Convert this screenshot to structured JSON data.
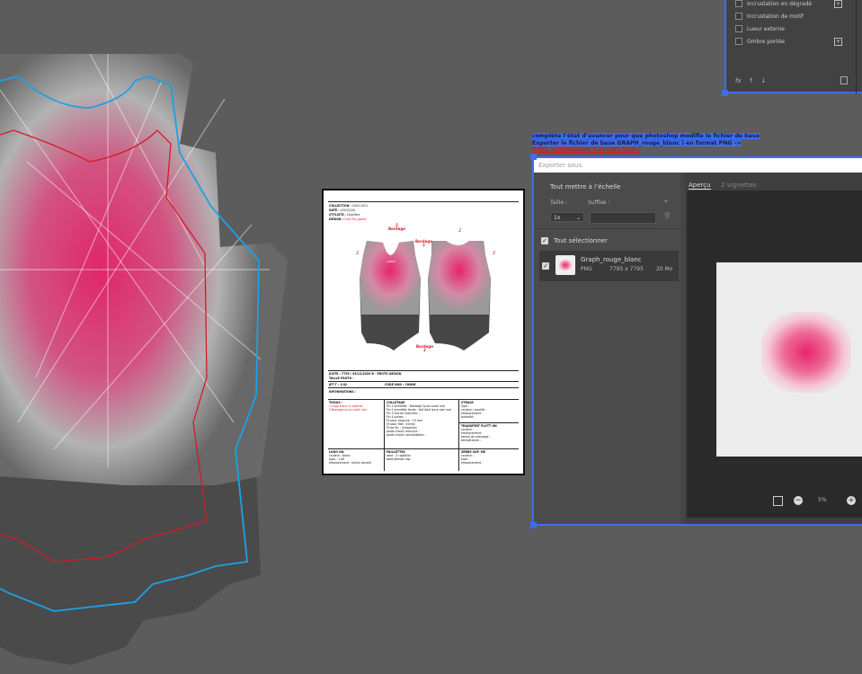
{
  "layer_style_panel": {
    "rows": [
      {
        "label": "Incrustation en dégradé",
        "has_plus": true
      },
      {
        "label": "Incrustation de motif",
        "has_plus": false
      },
      {
        "label": "Lueur externe",
        "has_plus": false
      },
      {
        "label": "Ombre portée",
        "has_plus": true
      }
    ],
    "footer_fx": "fx"
  },
  "note": {
    "line1": "complète l’état d’avancer pour que photoshop modifie le fichier de base",
    "line2": "Exporter le fichier de base GRAPH_rouge_blanc ) en format PNG ->",
    "line3": "JPEG, compression 1  et nom final :"
  },
  "document": {
    "header": [
      {
        "k": "COLLECTION :",
        "v": "2020-2021"
      },
      {
        "k": "DATE :",
        "v": "(03/12/20)"
      },
      {
        "k": "STYLISTE :",
        "v": "Charlène"
      },
      {
        "k": "DESIGN :",
        "v": "Club Pro_Agnès"
      }
    ],
    "bordage_top": "Bordage",
    "bordage_top2": "Bordage",
    "bordage_bottom": "Bordage",
    "num": "2",
    "logo": "ALPHA",
    "mid": [
      "JUSTE : 7799 / 05/12/2020 B - PROTO DESIGN",
      "TAILLE PROTO :",
      "JET T : 1/42",
      "CODE NUN : CHN98"
    ],
    "informations": "INFORMATIONS :",
    "tissus_title": "TISSUS :",
    "tissus": [
      "1 lingo blanc & sublimé",
      "2 Bordage lycra corail noir"
    ],
    "coloris_title": "COLLETAGE",
    "coloris": [
      "Fin 1 emmêler : Bordage lycra corail noir",
      "Fin 2 emmêler fonds : fait dixit lycra noir noir",
      "Fin 3 fort de manches :",
      "Fin 4 autres :",
      "",
      "Fil pour coupure : 10 mm",
      "Fil pour fixé : 40mm",
      "Fil de fer : Cheppillon",
      "poids d'outil recouvre :",
      "poids d'outil consolidation :"
    ],
    "strass_title": "STRASS",
    "strass": [
      "type :",
      "couleur / qualité :",
      "emplacement :",
      "quantité :"
    ],
    "transfert_title": "TRANSFERT FLOTT ON",
    "transfert": [
      "couleur :",
      "emplacement :",
      "temps de pressage :",
      "température :"
    ],
    "logo_title": "LOGO ON",
    "logo_lines": [
      "couleur : blanc",
      "type : 1 dé",
      "emplacement : milieu devant"
    ],
    "paillettes_title": "PAILLETTES",
    "paillettes": [
      "nbre : 2 rigolillon",
      "bord demain top :"
    ],
    "auth_title": "ZÉBRE SUP. ME",
    "auth": [
      "couleur :",
      "type :",
      "emplacement :"
    ]
  },
  "export_dialog": {
    "title": "Exporter sous",
    "scale_all": "Tout mettre à l’échelle",
    "size_label": "Taille :",
    "suffix_label": "Suffixe :",
    "size_value": "1x",
    "suffix_value": "",
    "add_symbol": "+",
    "select_all": "Tout sélectionner",
    "file_name": "Graph_rouge_blanc",
    "file_format": "PNG",
    "file_dims": "7795 x 7795",
    "file_size": "20 Mo",
    "tab_preview": "Aperçu",
    "tab_thumbs": "2 vignettes",
    "zoom": "5%",
    "zoom_minus": "−",
    "zoom_plus": "+"
  },
  "colors": {
    "accent": "#3b6ef0",
    "pink": "#e8246a",
    "red_mark": "#d31b28",
    "blue_line": "#1ea0e6"
  }
}
